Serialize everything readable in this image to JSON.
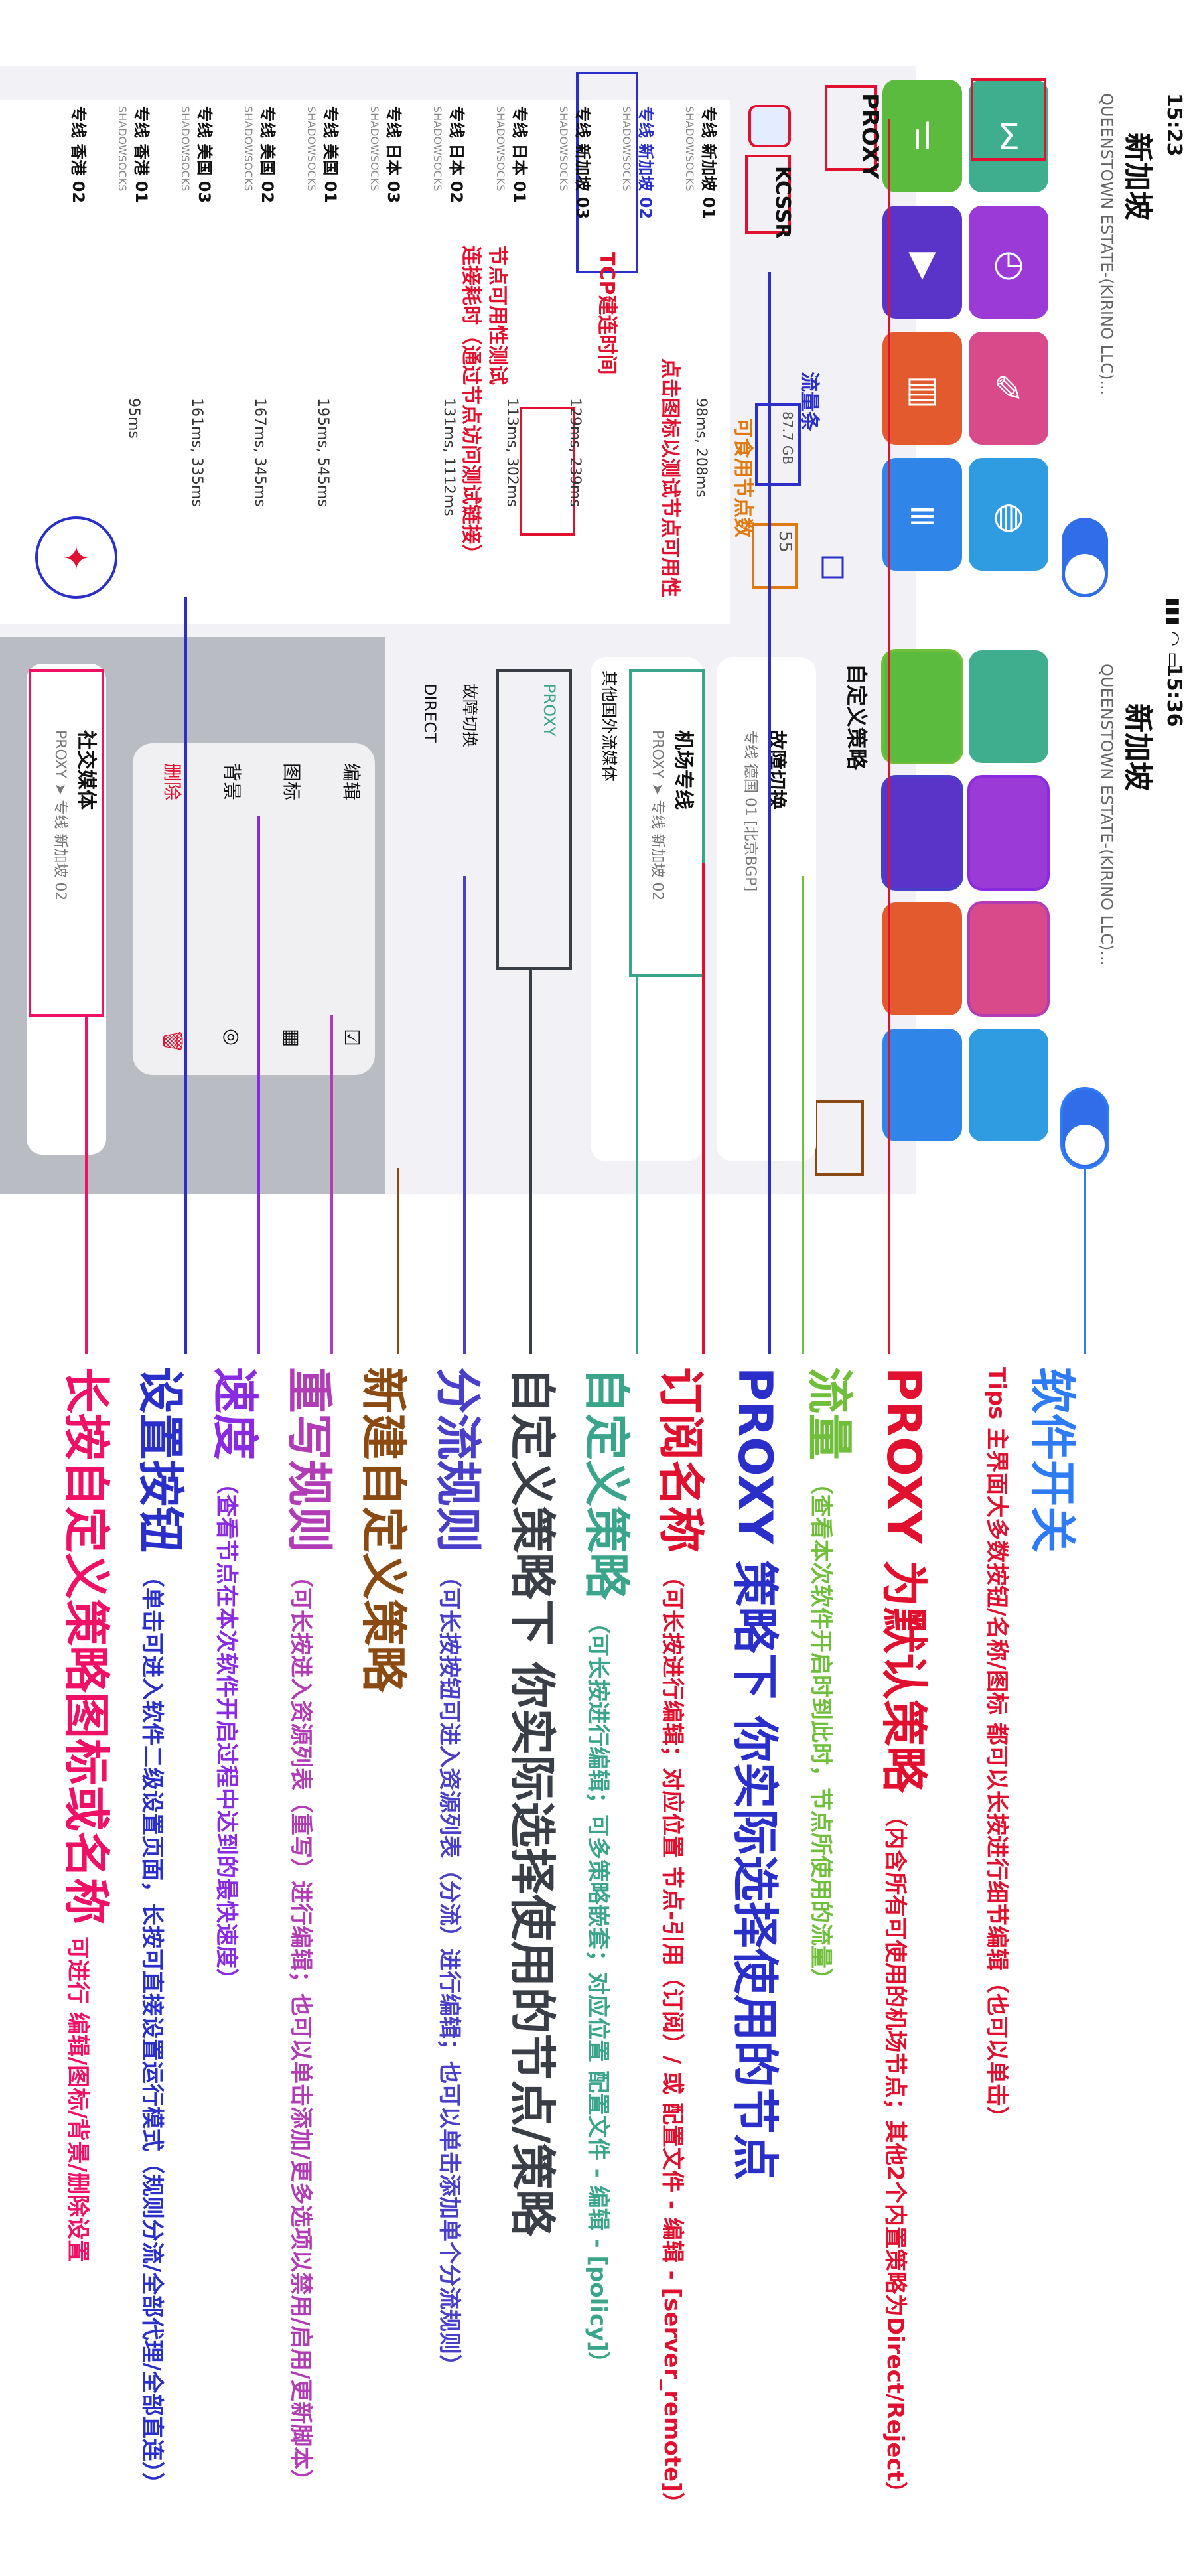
{
  "phone1": {
    "time": "15:23",
    "location_title": "新加坡",
    "location_sub": "QUEENSTOWN ESTATE-(KIRINO LLC)...",
    "proxy_label": "PROXY",
    "subscription": "KCSSR",
    "traffic": "87.7 GB",
    "available_count": "55",
    "nodes": [
      {
        "name": "专线 新加坡 01",
        "type": "SHADOWSOCKS",
        "latency": "98ms, 208ms"
      },
      {
        "name": "专线 新加坡 02",
        "type": "SHADOWSOCKS",
        "latency": ""
      },
      {
        "name": "专线 新加坡 03",
        "type": "SHADOWSOCKS",
        "latency": "129ms, 239ms"
      },
      {
        "name": "专线 日本 01",
        "type": "SHADOWSOCKS",
        "latency": "113ms, 302ms"
      },
      {
        "name": "专线 日本 02",
        "type": "SHADOWSOCKS",
        "latency": "131ms, 1112ms"
      },
      {
        "name": "专线 日本 03",
        "type": "SHADOWSOCKS",
        "latency": ""
      },
      {
        "name": "专线 美国 01",
        "type": "SHADOWSOCKS",
        "latency": "195ms, 545ms"
      },
      {
        "name": "专线 美国 02",
        "type": "SHADOWSOCKS",
        "latency": "167ms, 345ms"
      },
      {
        "name": "专线 美国 03",
        "type": "SHADOWSOCKS",
        "latency": "161ms, 335ms"
      },
      {
        "name": "专线 香港 01",
        "type": "SHADOWSOCKS",
        "latency": "95ms"
      },
      {
        "name": "专线 香港 02",
        "type": "",
        "latency": ""
      }
    ],
    "annotations": {
      "traffic_bar": "流量条",
      "available_nodes": "可食用节点数",
      "tap_icon": "点击图标以测试节点可用性",
      "tcp_time": "TCP建连时间",
      "availability_test": "节点可用性测试",
      "latency_note": "连接耗时（通过节点访问测试链接）"
    }
  },
  "phone2": {
    "time": "15:36",
    "location_title": "新加坡",
    "location_sub": "QUEENSTOWN ESTATE-(KIRINO LLC)...",
    "custom_policy_title": "自定义策略",
    "cards": [
      {
        "name": "故障切换",
        "sub": "专线 德国 01 [北京BGP]"
      },
      {
        "name": "机场专线",
        "sub": "PROXY ➤ 专线 新加坡 02"
      }
    ],
    "options": [
      "其他国外流媒体",
      "PROXY",
      "故障切换",
      "DIRECT"
    ],
    "menu": [
      {
        "label": "编辑",
        "icon": "☑"
      },
      {
        "label": "图标",
        "icon": "▦"
      },
      {
        "label": "背景",
        "icon": "◎"
      },
      {
        "label": "删除",
        "icon": "🗑"
      }
    ],
    "social": {
      "name": "社交媒体",
      "sub": "PROXY ➤ 专线 新加坡 02"
    }
  },
  "legend": [
    {
      "title": "软件开关",
      "desc": "",
      "color": "#2e7bf6"
    },
    {
      "title": "Tips 主界面大多数按钮/名称/图标 都可以长按进行细节编辑（也可以单击）",
      "desc": "",
      "color": "#e0102e"
    },
    {
      "title": "PROXY 为默认策略",
      "desc": "（内含所有可使用的机场节点；其他2个内置策略为Direct/Reject）",
      "color": "#e0102e"
    },
    {
      "title": "流量",
      "desc": "（查看本次软件开启时到此时，节点所使用的流量）",
      "color": "#6fbf3a"
    },
    {
      "title": "PROXY 策略下 你实际选择使用的节点",
      "desc": "",
      "color": "#2a2fc9"
    },
    {
      "title": "订阅名称",
      "desc": "（可长按进行编辑；对应位置 节点-引用（订阅）/ 或 配置文件 - 编辑 - [server_remote]）",
      "color": "#e0102e"
    },
    {
      "title": "自定义策略",
      "desc": "（可长按进行编辑；可多策略嵌套；对应位置 配置文件 - 编辑 - [policy]）",
      "color": "#3aa58a"
    },
    {
      "title": "自定义策略下 你实际选择使用的节点/策略",
      "desc": "",
      "color": "#3a3f47"
    },
    {
      "title": "分流规则",
      "desc": "（可长按按钮可进入资源列表（分流）进行编辑；也可以单击添加单个分流规则）",
      "color": "#4a3fc9"
    },
    {
      "title": "新建自定义策略",
      "desc": "",
      "color": "#8a4a12"
    },
    {
      "title": "重写规则",
      "desc": "（可长按进入资源列表（重写）进行编辑；也可以单击添加/更多选项以禁用/启用/更新脚本）",
      "color": "#b23cb5"
    },
    {
      "title": "速度",
      "desc": "（查看节点在本次软件开启过程中达到的最快速度）",
      "color": "#8a2be2"
    },
    {
      "title": "设置按钮",
      "desc": "（单击可进入软件二级设置页面，长按可直接设置运行模式（规则分流/全部代理/全部直连））",
      "color": "#2a2fc9"
    },
    {
      "title": "长按自定义策略图标或名称",
      "desc": "可进行 编辑/图标/背景/删除设置",
      "color": "#ee1166"
    }
  ]
}
